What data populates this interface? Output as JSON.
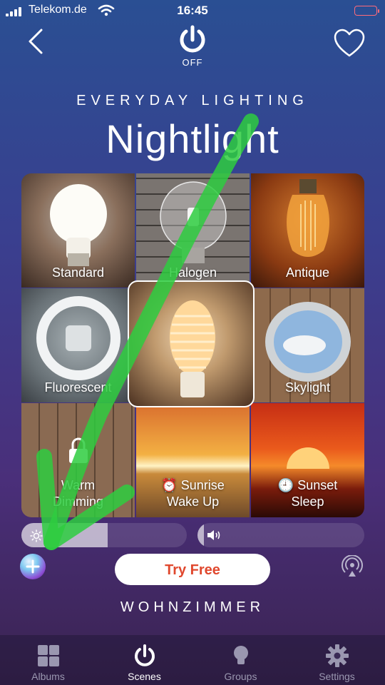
{
  "status_bar": {
    "carrier": "Telekom.de",
    "time": "16:45"
  },
  "header": {
    "power_state": "OFF",
    "subtitle": "EVERYDAY LIGHTING",
    "title": "Nightlight"
  },
  "scenes": [
    {
      "label": "Standard"
    },
    {
      "label": "Halogen"
    },
    {
      "label": "Antique"
    },
    {
      "label": "Fluorescent"
    },
    {
      "label": ""
    },
    {
      "label": "Skylight"
    },
    {
      "label_line1": "Warm",
      "label_line2": "Dimming",
      "locked": true
    },
    {
      "label_line1": "Sunrise",
      "label_line2": "Wake Up",
      "icon": "alarm-clock-icon"
    },
    {
      "label_line1": "Sunset",
      "label_line2": "Sleep",
      "icon": "clock-icon"
    }
  ],
  "selected_scene_index": 4,
  "controls": {
    "brightness_level": 0.52,
    "volume_level": 0.04,
    "try_free_label": "Try Free",
    "room_name": "WOHNZIMMER"
  },
  "tabs": [
    {
      "label": "Albums",
      "icon": "grid-icon"
    },
    {
      "label": "Scenes",
      "icon": "power-icon",
      "active": true
    },
    {
      "label": "Groups",
      "icon": "bulb-icon"
    },
    {
      "label": "Settings",
      "icon": "gear-icon"
    }
  ],
  "colors": {
    "accent": "#e0482e",
    "annotation": "#2ecc40"
  }
}
